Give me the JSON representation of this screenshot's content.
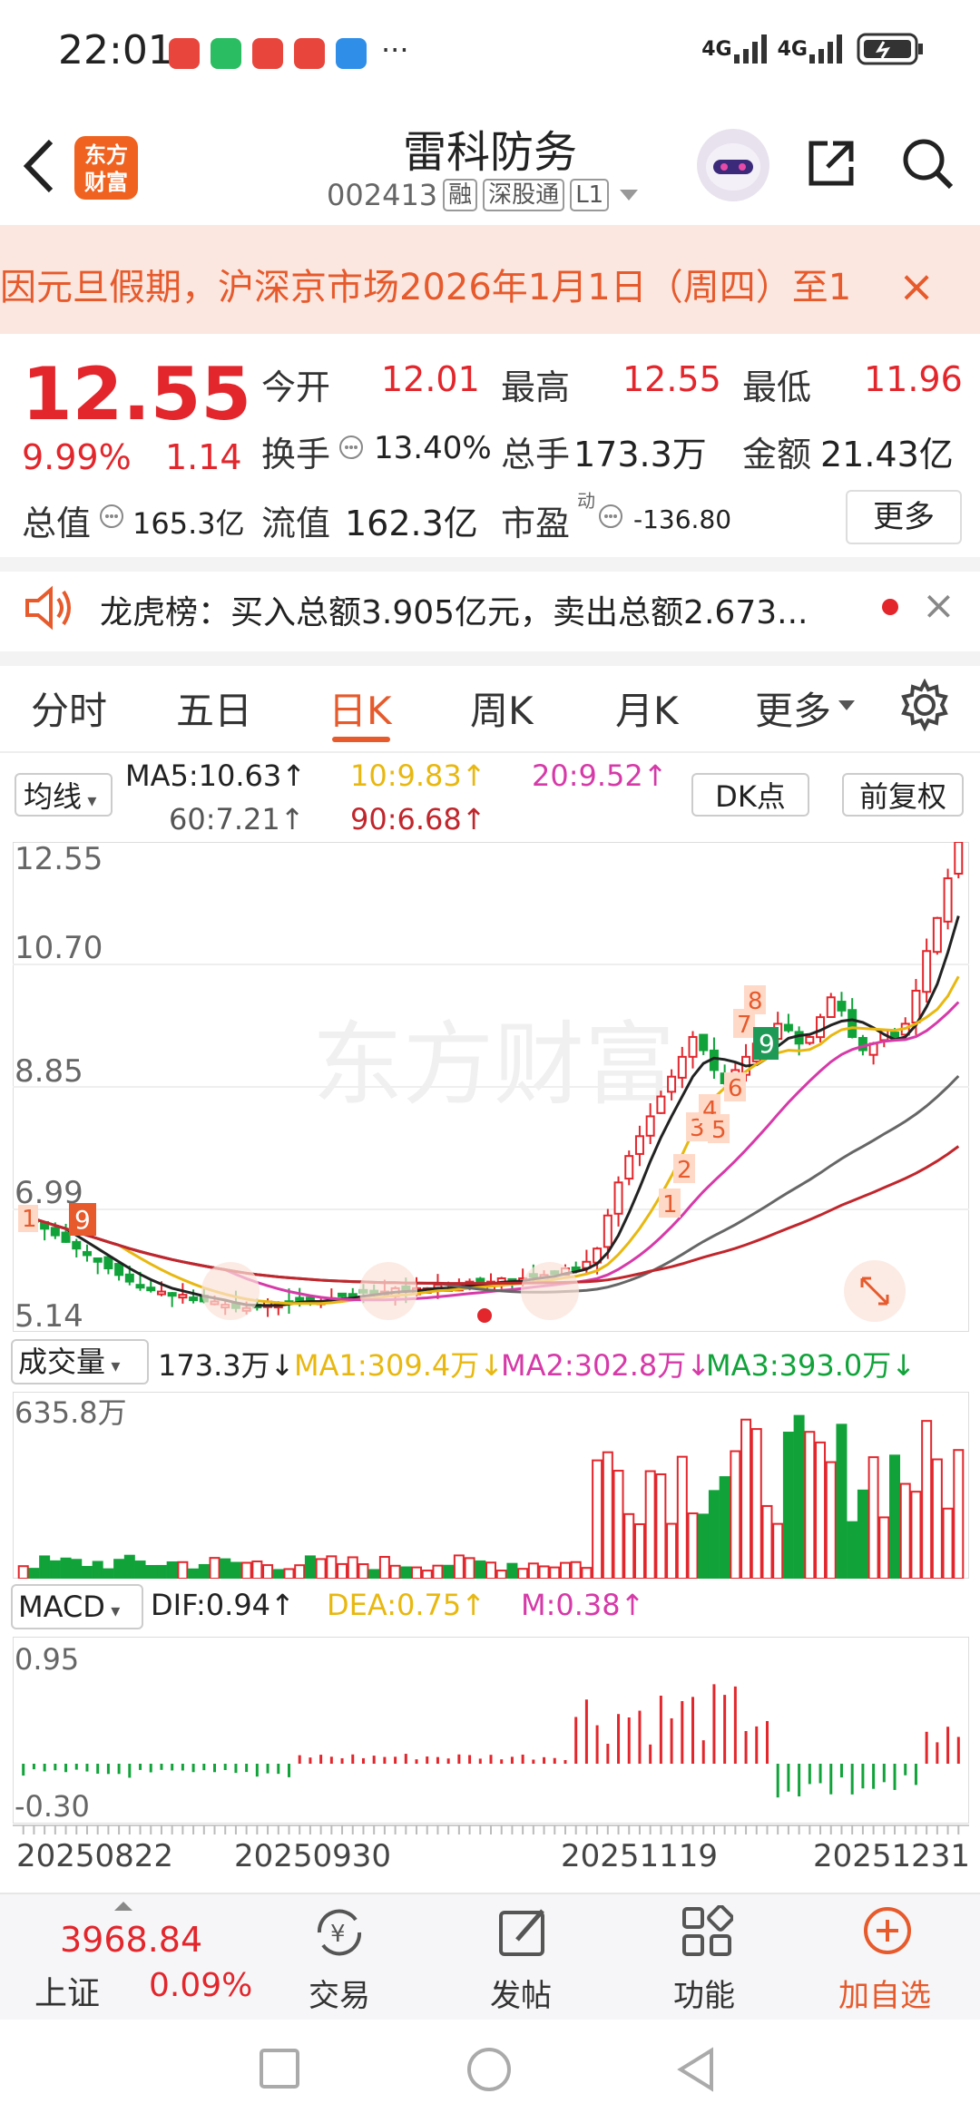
{
  "status": {
    "time": "22:01",
    "dots": "···",
    "net1": "4G",
    "net2": "4G"
  },
  "header": {
    "logo": [
      "东方",
      "财富"
    ],
    "name": "雷科防务",
    "code": "002413",
    "tags": [
      "融",
      "深股通",
      "L1"
    ]
  },
  "notice": {
    "text": "因元旦假期，沪深京市场2026年1月1日（周四）至1",
    "close": "×"
  },
  "quote": {
    "price": "12.55",
    "pct": "9.99%",
    "change": "1.14",
    "open_label": "今开",
    "open": "12.01",
    "high_label": "最高",
    "high": "12.55",
    "low_label": "最低",
    "low": "11.96",
    "turnover_label": "换手",
    "turnover": "13.40%",
    "volume_label": "总手",
    "volume": "173.3万",
    "amount_label": "金额",
    "amount": "21.43亿",
    "mktcap_label": "总值",
    "mktcap": "165.3亿",
    "float_label": "流值",
    "float": "162.3亿",
    "pe_label": "市盈",
    "pe_sup": "动",
    "pe": "-136.80",
    "more": "更多"
  },
  "dragon": {
    "text": "龙虎榜：买入总额3.905亿元，卖出总额2.673...",
    "close": "×"
  },
  "tabs": [
    "分时",
    "五日",
    "日K",
    "周K",
    "月K",
    "更多"
  ],
  "active_tab": "日K",
  "ma_legend": {
    "button": "均线",
    "ma5": "MA5:10.63↑",
    "ma10": "10:9.83↑",
    "ma20": "20:9.52↑",
    "ma60": "60:7.21↑",
    "ma90": "90:6.68↑",
    "dk": "DK点",
    "fq": "前复权"
  },
  "colors": {
    "up": "#e2262c",
    "down": "#11a33a",
    "accent": "#e65a2c",
    "ma5": "#222222",
    "ma10": "#e8b810",
    "ma20": "#d63aa8",
    "ma60": "#666666",
    "ma90": "#c0262c"
  },
  "price_axis": [
    "12.55",
    "10.70",
    "8.85",
    "6.99",
    "5.14"
  ],
  "watermark": "东方财富",
  "td_labels": [
    "1",
    "2",
    "3",
    "4",
    "5",
    "6",
    "7",
    "8",
    "9"
  ],
  "volume_legend": {
    "button": "成交量",
    "vol": "173.3万↓",
    "ma1": "MA1:309.4万↓",
    "ma2": "MA2:302.8万↓",
    "ma3": "MA3:393.0万↓",
    "max": "635.8万"
  },
  "macd_legend": {
    "button": "MACD",
    "dif": "DIF:0.94↑",
    "dea": "DEA:0.75↑",
    "m": "M:0.38↑",
    "top": "0.95",
    "bottom": "-0.30"
  },
  "dates": [
    "20250822",
    "20250930",
    "20251119",
    "20251231"
  ],
  "chart_data": {
    "type": "candlestick",
    "y_range": [
      5.14,
      12.55
    ],
    "last_close": 12.55,
    "trend_closes": [
      6.9,
      6.8,
      6.7,
      6.6,
      6.5,
      6.4,
      6.3,
      6.2,
      6.1,
      6.0,
      5.9,
      5.85,
      5.8,
      5.75,
      5.7,
      5.7,
      5.65,
      5.6,
      5.6,
      5.55,
      5.5,
      5.5,
      5.55,
      5.6,
      5.55,
      5.6,
      5.65,
      5.6,
      5.6,
      5.65,
      5.7,
      5.7,
      5.75,
      5.7,
      5.75,
      5.8,
      5.75,
      5.8,
      5.8,
      5.85,
      5.8,
      5.85,
      5.9,
      5.85,
      5.9,
      5.95,
      5.9,
      5.95,
      6.0,
      6.0,
      6.05,
      6.1,
      6.1,
      6.2,
      6.4,
      6.9,
      7.4,
      7.8,
      8.1,
      8.4,
      8.7,
      9.0,
      9.3,
      9.6,
      9.4,
      9.1,
      8.9,
      9.1,
      9.3,
      9.5,
      9.6,
      9.8,
      9.7,
      9.5,
      9.6,
      9.9,
      10.2,
      10.0,
      9.6,
      9.4,
      9.5,
      9.7,
      9.6,
      9.8,
      10.3,
      10.9,
      11.4,
      12.0,
      12.55
    ]
  },
  "bottom": {
    "index_value": "3968.84",
    "index_name": "上证",
    "index_pct": "0.09%",
    "trade": "交易",
    "post": "发帖",
    "func": "功能",
    "add": "加自选"
  }
}
